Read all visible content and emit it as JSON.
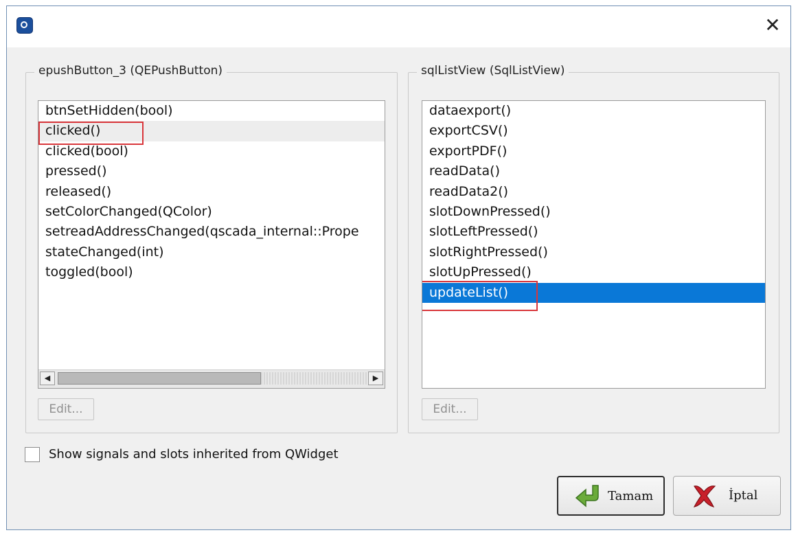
{
  "window": {
    "close_glyph": "✕"
  },
  "left_panel": {
    "title": "epushButton_3 (QEPushButton)",
    "items": [
      "btnSetHidden(bool)",
      "clicked()",
      "clicked(bool)",
      "pressed()",
      "released()",
      "setColorChanged(QColor)",
      "setreadAddressChanged(qscada_internal::Prope",
      "stateChanged(int)",
      "toggled(bool)"
    ],
    "highlighted_item": "clicked()",
    "edit_label": "Edit..."
  },
  "right_panel": {
    "title": "sqlListView (SqlListView)",
    "items": [
      "dataexport()",
      "exportCSV()",
      "exportPDF()",
      "readData()",
      "readData2()",
      "slotDownPressed()",
      "slotLeftPressed()",
      "slotRightPressed()",
      "slotUpPressed()",
      "updateList()"
    ],
    "selected_item": "updateList()",
    "edit_label": "Edit..."
  },
  "checkbox": {
    "label": "Show signals and slots inherited from QWidget",
    "checked": false
  },
  "buttons": {
    "ok_label": "Tamam",
    "cancel_label": "İptal"
  },
  "colors": {
    "selection": "#0a78d7",
    "annotation_box": "#d9363b",
    "ok_icon": "#6bab3a",
    "cancel_icon": "#c8202a"
  }
}
